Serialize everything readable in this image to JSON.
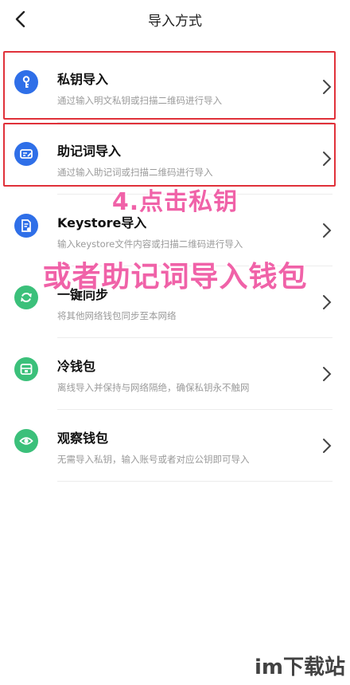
{
  "header": {
    "title": "导入方式"
  },
  "items": [
    {
      "name": "私钥导入",
      "desc": "通过输入明文私钥或扫描二维码进行导入",
      "icon": "key-icon",
      "color": "#2f6fe8"
    },
    {
      "name": "助记词导入",
      "desc": "通过输入助记词或扫描二维码进行导入",
      "icon": "mnemonic-card-icon",
      "color": "#2f6fe8"
    },
    {
      "name": "Keystore导入",
      "desc": "输入keystore文件内容或扫描二维码进行导入",
      "icon": "keystore-file-icon",
      "color": "#2f6fe8"
    },
    {
      "name": "一键同步",
      "desc": "将其他网络钱包同步至本网络",
      "icon": "sync-icon",
      "color": "#3bc07a"
    },
    {
      "name": "冷钱包",
      "desc": "离线导入并保持与网络隔绝，确保私钥永不触网",
      "icon": "cold-wallet-icon",
      "color": "#3bc07a"
    },
    {
      "name": "观察钱包",
      "desc": "无需导入私钥，输入账号或者对应公钥即可导入",
      "icon": "eye-icon",
      "color": "#3bc07a"
    }
  ],
  "annotation": {
    "line1": "4.点击私钥",
    "line2": "或者助记词导入钱包",
    "color": "#f062a8"
  },
  "watermark": {
    "text": "im下载站"
  },
  "highlight_color": "#e0313a"
}
